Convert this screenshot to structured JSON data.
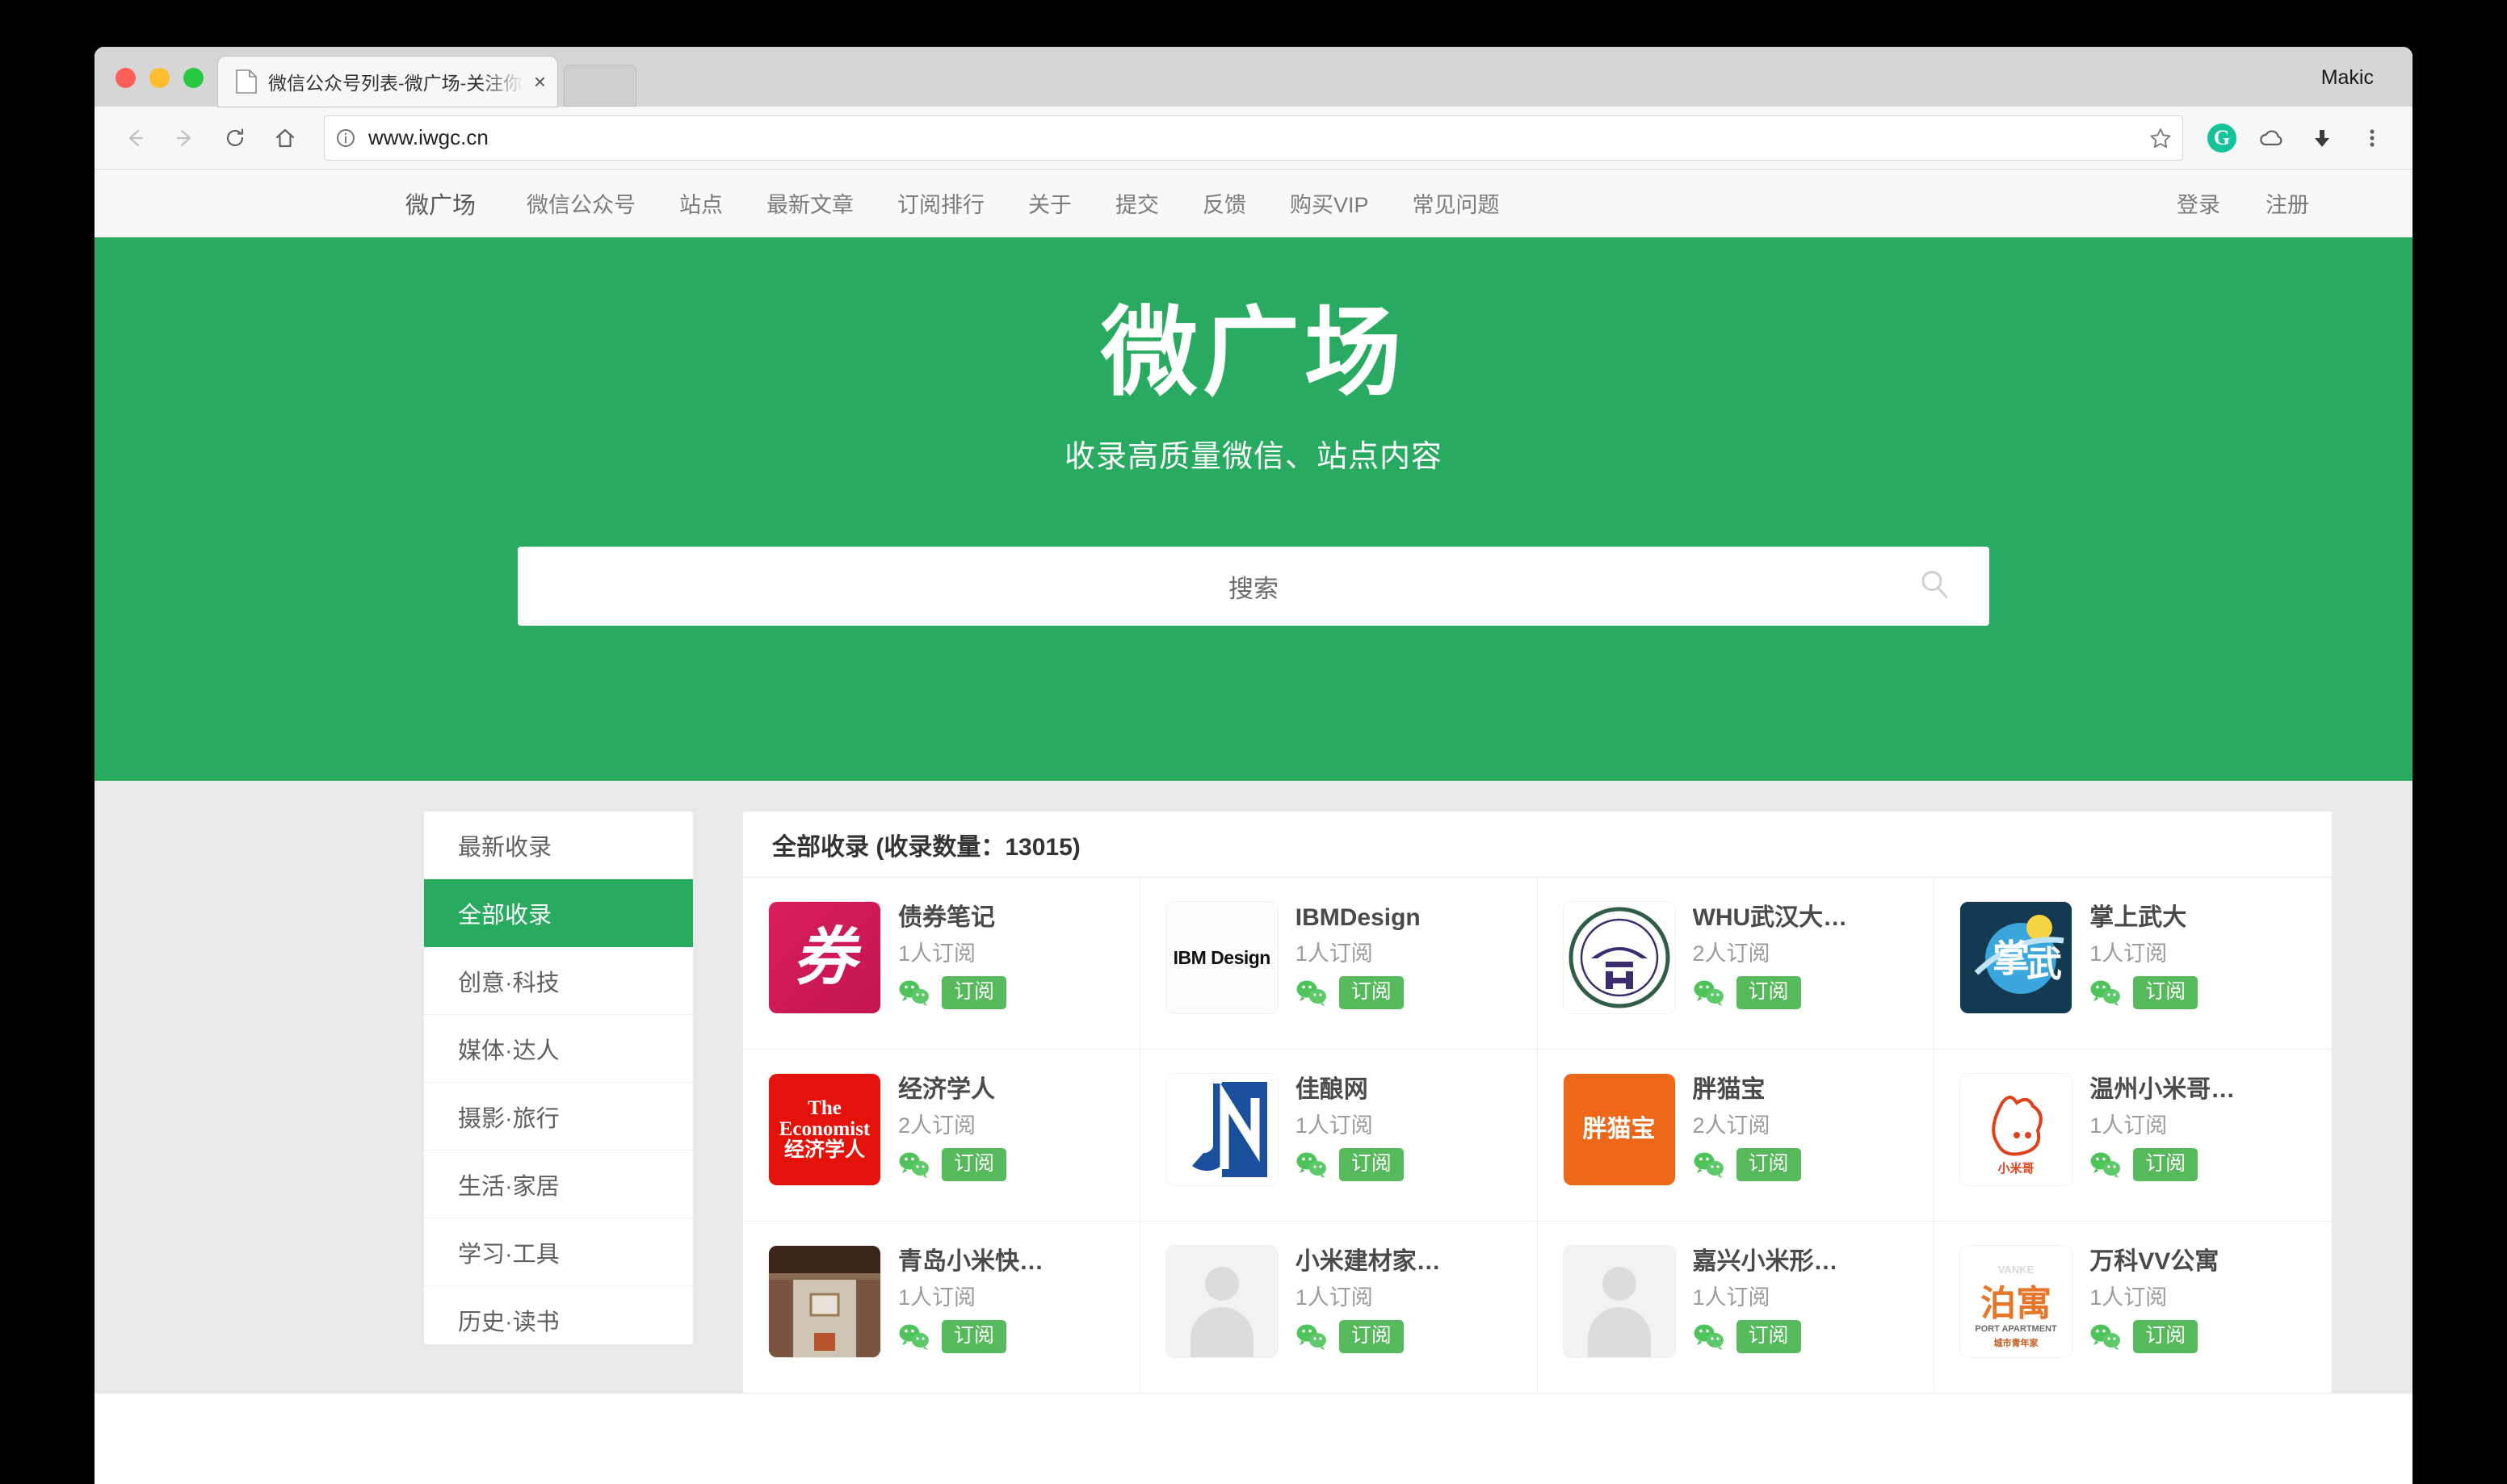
{
  "browser": {
    "tab_title": "微信公众号列表-微广场-关注你",
    "tab_close_label": "×",
    "profile_name": "Makic",
    "url": "www.iwgc.cn",
    "icons": {
      "back": "back-arrow-icon",
      "forward": "forward-arrow-icon",
      "reload": "reload-icon",
      "home": "home-icon",
      "info": "info-icon",
      "star": "star-icon",
      "grammarly": "G",
      "cloud": "cloud-icon",
      "download": "download-icon",
      "menu": "three-dot-menu-icon"
    }
  },
  "site_nav": {
    "brand": "微广场",
    "items": [
      {
        "label": "微信公众号"
      },
      {
        "label": "站点"
      },
      {
        "label": "最新文章"
      },
      {
        "label": "订阅排行"
      },
      {
        "label": "关于"
      },
      {
        "label": "提交"
      },
      {
        "label": "反馈"
      },
      {
        "label": "购买VIP"
      },
      {
        "label": "常见问题"
      }
    ],
    "right_items": [
      {
        "label": "登录"
      },
      {
        "label": "注册"
      }
    ]
  },
  "hero": {
    "title": "微广场",
    "subtitle": "收录高质量微信、站点内容",
    "background_color": "#28ab60"
  },
  "search": {
    "placeholder": "搜索",
    "value": "",
    "icon": "search-icon"
  },
  "sidebar": {
    "items": [
      {
        "label": "最新收录",
        "active": false
      },
      {
        "label": "全部收录",
        "active": true
      },
      {
        "label": "创意·科技",
        "active": false
      },
      {
        "label": "媒体·达人",
        "active": false
      },
      {
        "label": "摄影·旅行",
        "active": false
      },
      {
        "label": "生活·家居",
        "active": false
      },
      {
        "label": "学习·工具",
        "active": false
      },
      {
        "label": "历史·读书",
        "active": false
      }
    ]
  },
  "main": {
    "panel_title": "全部收录 (收录数量：13015)",
    "total_count": 13015,
    "subscribe_label": "订阅",
    "wechat_icon": "wechat-icon",
    "cards": [
      {
        "name": "债券笔记",
        "subs": "1人订阅",
        "logo": "zhaiquan",
        "logo_text": "券"
      },
      {
        "name": "IBMDesign",
        "subs": "1人订阅",
        "logo": "ibm",
        "logo_text": "IBM Design"
      },
      {
        "name": "WHU武汉大…",
        "subs": "2人订阅",
        "logo": "whu",
        "logo_text": ""
      },
      {
        "name": "掌上武大",
        "subs": "1人订阅",
        "logo": "zswd",
        "logo_text": "掌武"
      },
      {
        "name": "经济学人",
        "subs": "2人订阅",
        "logo": "econ",
        "logo_text": "The Economist 经济学人"
      },
      {
        "name": "佳酿网",
        "subs": "1人订阅",
        "logo": "jn",
        "logo_text": "JN"
      },
      {
        "name": "胖猫宝",
        "subs": "2人订阅",
        "logo": "pmb",
        "logo_text": "胖猫宝"
      },
      {
        "name": "温州小米哥…",
        "subs": "1人订阅",
        "logo": "wzxm",
        "logo_text": "小米哥"
      },
      {
        "name": "青岛小米快…",
        "subs": "1人订阅",
        "logo": "qd",
        "logo_text": ""
      },
      {
        "name": "小米建材家…",
        "subs": "1人订阅",
        "logo": "blank",
        "logo_text": ""
      },
      {
        "name": "嘉兴小米形…",
        "subs": "1人订阅",
        "logo": "blank",
        "logo_text": ""
      },
      {
        "name": "万科VV公寓",
        "subs": "1人订阅",
        "logo": "vanke",
        "logo_text": "泊寓"
      }
    ]
  },
  "colors": {
    "brand_green": "#28ab60",
    "button_green": "#56b95c",
    "page_bg": "#e9e9e9"
  }
}
